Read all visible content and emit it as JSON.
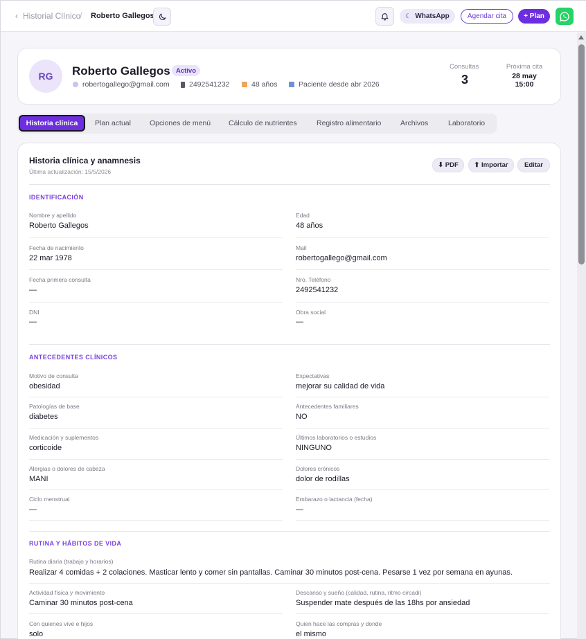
{
  "breadcrumb": {
    "back_label": "Historial Clínico",
    "separator": "/",
    "current": "Roberto Gallegos"
  },
  "header_actions": {
    "whatsapp_label": "WhatsApp",
    "schedule_label": "Agendar cita",
    "plan_label": "+ Plan"
  },
  "patient": {
    "initials": "RG",
    "name": "Roberto Gallegos",
    "status": "Activo",
    "email": "robertogallego@gmail.com",
    "phone": "2492541232",
    "age": "48 años",
    "since": "Paciente desde abr 2026",
    "consultas_label": "Consultas",
    "consultas_value": "3",
    "next_label": "Próxima cita",
    "next_date": "28 may",
    "next_time": "15:00"
  },
  "tabs": [
    {
      "label": "Historia clínica"
    },
    {
      "label": "Plan actual"
    },
    {
      "label": "Opciones de menú"
    },
    {
      "label": "Cálculo de nutrientes"
    },
    {
      "label": "Registro alimentario"
    },
    {
      "label": "Archivos"
    },
    {
      "label": "Laboratorio"
    }
  ],
  "main": {
    "title": "Historia clínica y anamnesis",
    "subtitle": "Última actualización: 15/5/2026",
    "pdf_label": "⬇ PDF",
    "import_label": "⬆ Importar",
    "edit_label": "Editar"
  },
  "identificacion": {
    "title": "IDENTIFICACIÓN",
    "fields": [
      {
        "label": "Nombre y apellido",
        "value": "Roberto Gallegos"
      },
      {
        "label": "Edad",
        "value": "48 años"
      },
      {
        "label": "Fecha de nacimiento",
        "value": "22 mar 1978"
      },
      {
        "label": "Mail",
        "value": "robertogallego@gmail.com"
      },
      {
        "label": "Fecha primera consulta",
        "value": "—"
      },
      {
        "label": "Nro. Teléfono",
        "value": "2492541232"
      },
      {
        "label": "DNI",
        "value": "—"
      },
      {
        "label": "Obra social",
        "value": "—"
      }
    ]
  },
  "antecedentes": {
    "title": "ANTECEDENTES CLÍNICOS",
    "fields": [
      {
        "label": "Motivo de consulta",
        "value": "obesidad"
      },
      {
        "label": "Expectativas",
        "value": "mejorar su calidad de vida"
      },
      {
        "label": "Patologías de base",
        "value": "diabetes"
      },
      {
        "label": "Antecedentes familiares",
        "value": "NO"
      },
      {
        "label": "Medicación y suplementos",
        "value": "corticoide"
      },
      {
        "label": "Últimos laboratorios o estudios",
        "value": "NINGUNO"
      },
      {
        "label": "Alergias o dolores de cabeza",
        "value": "MANI"
      },
      {
        "label": "Dolores crónicos",
        "value": "dolor de rodillas"
      },
      {
        "label": "Ciclo menstrual",
        "value": "—"
      },
      {
        "label": "Embarazo o lactancia (fecha)",
        "value": "—"
      }
    ]
  },
  "rutina": {
    "title": "RUTINA Y HÁBITOS DE VIDA",
    "daily_label": "Rutina diaria (trabajo y horarios)",
    "daily_value": "Realizar 4 comidas + 2 colaciones. Masticar lento y comer sin pantallas. Caminar 30 minutos post-cena. Pesarse 1 vez por semana en ayunas.",
    "fields": [
      {
        "label": "Actividad física y movimiento",
        "value": "Caminar 30 minutos post-cena"
      },
      {
        "label": "Descanso y sueño (calidad, rutina, ritmo circadi)",
        "value": "Suspender mate después de las 18hs por ansiedad"
      },
      {
        "label": "Con quienes vive e hijos",
        "value": "solo"
      },
      {
        "label": "Quien hace las compras y donde",
        "value": "el mismo"
      }
    ]
  },
  "colors": {
    "accent": "#6d2ee0",
    "whatsapp": "#25d366",
    "section_title": "#7b3fe4"
  }
}
